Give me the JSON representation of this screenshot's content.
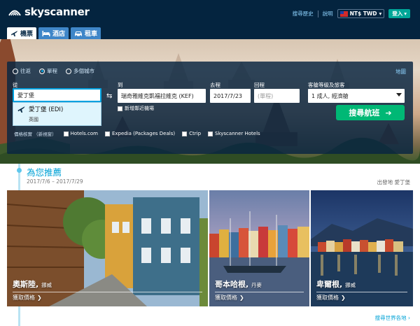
{
  "brand": {
    "name": "skyscanner",
    "accent": "#00a2d6",
    "header_bg": "#04243f",
    "cta": "#00b875"
  },
  "header": {
    "history": "搜尋歷史",
    "help": "說明",
    "currency": "NT$ TWD",
    "currency_icon": "taiwan-flag-icon",
    "login": "登入"
  },
  "tabs": [
    {
      "label": "機票",
      "icon": "plane-icon",
      "active": true
    },
    {
      "label": "酒店",
      "icon": "bed-icon",
      "active": false
    },
    {
      "label": "租車",
      "icon": "car-icon",
      "active": false
    }
  ],
  "search": {
    "trip_types": [
      {
        "label": "往返",
        "selected": false
      },
      {
        "label": "單程",
        "selected": true
      },
      {
        "label": "多個城市",
        "selected": false
      }
    ],
    "map_link": "地圖",
    "from_label": "從",
    "from_value": "愛丁堡",
    "to_label": "到",
    "to_value": "瑞奇雅維克凱福拉維克 (KEF)",
    "depart_label": "去程",
    "depart_value": "2017/7/23",
    "return_label": "回程",
    "return_value": "(單程)",
    "cabin_label": "客艙等級及旅客",
    "cabin_value": "1 成人, 經濟艙",
    "nearby_label": "新增鄰近機場",
    "submit_label": "搜尋航班",
    "compare_label": "價格核實 （新視窗）",
    "compare_options": [
      "Hotels.com",
      "Expedia (Packages Deals)",
      "Ctrip",
      "Skyscanner Hotels"
    ]
  },
  "autocomplete": {
    "title": "愛丁堡 (EDI)",
    "subtitle": "英國"
  },
  "recommendations": {
    "title": "為您推薦",
    "dates": "2017/7/6 – 2017/7/29",
    "origin": "出發地 愛丁堡",
    "cards": [
      {
        "city": "奧斯陸,",
        "country": "挪威",
        "action": "獲取價格"
      },
      {
        "city": "哥本哈根,",
        "country": "丹麥",
        "action": "獲取價格"
      },
      {
        "city": "卑爾根,",
        "country": "挪威",
        "action": "獲取價格"
      }
    ],
    "world_link": "搜尋世界各地 ›"
  }
}
